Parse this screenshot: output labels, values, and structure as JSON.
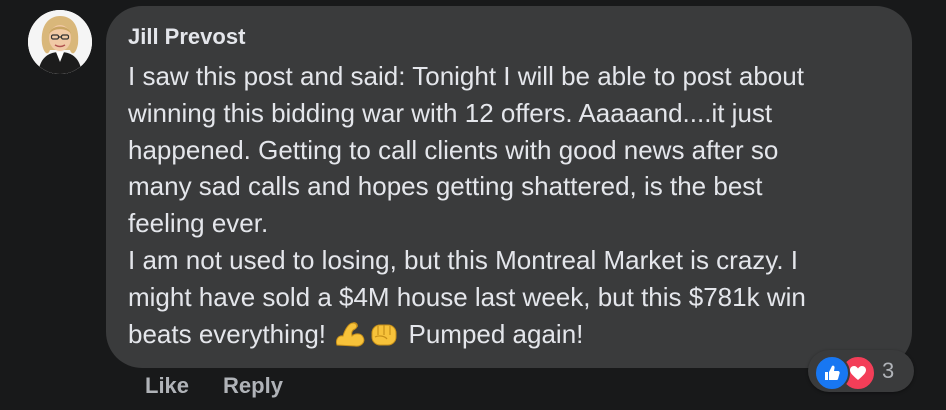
{
  "comment": {
    "author": "Jill Prevost",
    "lines": [
      "I saw this post and said: Tonight I will be able to post about",
      "winning this bidding war with 12 offers. Aaaaand....it just",
      "happened. Getting to call clients with good news after so",
      "many sad calls and hopes getting shattered, is the best",
      "feeling ever.",
      "I am not used to losing, but this Montreal Market is crazy. I",
      "might have sold a $4M house last week, but this $781k win",
      "beats everything!",
      "Pumped again!"
    ],
    "emojis": [
      "flexed-biceps-icon",
      "oncoming-fist-icon"
    ]
  },
  "actions": {
    "like_label": "Like",
    "reply_label": "Reply"
  },
  "reactions": {
    "types": [
      "like",
      "love"
    ],
    "count": "3"
  },
  "colors": {
    "page_background": "#18191a",
    "bubble_background": "#3a3b3c",
    "primary_text": "#e4e6eb",
    "secondary_text": "#b0b3b8",
    "like_blue": "#1877f2",
    "love_red": "#f33e58"
  }
}
